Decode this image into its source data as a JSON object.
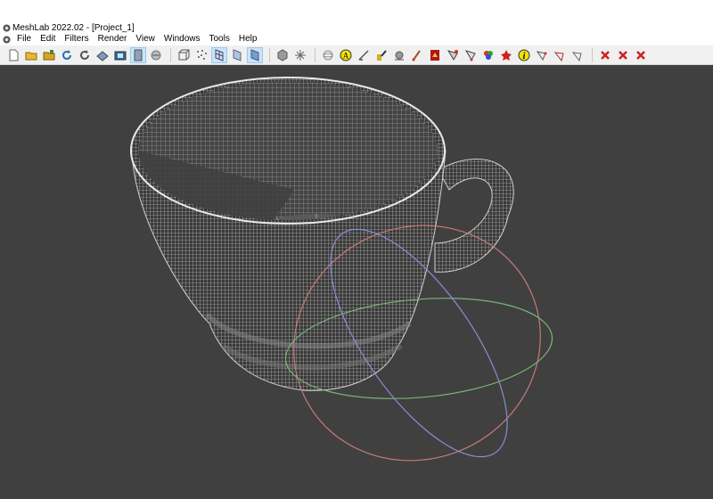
{
  "window": {
    "title": "MeshLab 2022.02 - [Project_1]"
  },
  "menu": {
    "items": [
      "File",
      "Edit",
      "Filters",
      "Render",
      "View",
      "Windows",
      "Tools",
      "Help"
    ]
  },
  "toolbar": {
    "groups": [
      [
        "new-file-icon",
        "open-folder-icon",
        "open-project-icon",
        "reload-icon",
        "reload-all-icon",
        "save-icon",
        "snapshot-icon",
        "layers-icon",
        "raster-icon"
      ],
      [
        "bounding-box-icon",
        "points-icon",
        "wireframe-icon",
        "flat-icon",
        "smooth-icon"
      ],
      [
        "flat-lines-icon",
        "light-icon"
      ],
      [
        "trackball-icon",
        "label-icon",
        "measure-icon",
        "align-icon",
        "select-icon",
        "paint-icon",
        "texture-icon",
        "select-faces-icon",
        "select-vertices-icon",
        "color-select-icon",
        "quoted-box-icon",
        "info-icon",
        "pick-points-icon",
        "manipulator-icon",
        "reference-icon"
      ],
      [
        "delete-faces-icon",
        "delete-vertices-icon",
        "delete-both-icon"
      ]
    ],
    "active": [
      "wireframe-icon",
      "smooth-icon"
    ]
  },
  "colors": {
    "viewport_bg": "#404040",
    "mesh": "#e6e6e6",
    "toolbar_bg": "#f0f0f0",
    "trackball_red": "#c87878",
    "trackball_green": "#78b478",
    "trackball_blue": "#8c8cd2"
  }
}
